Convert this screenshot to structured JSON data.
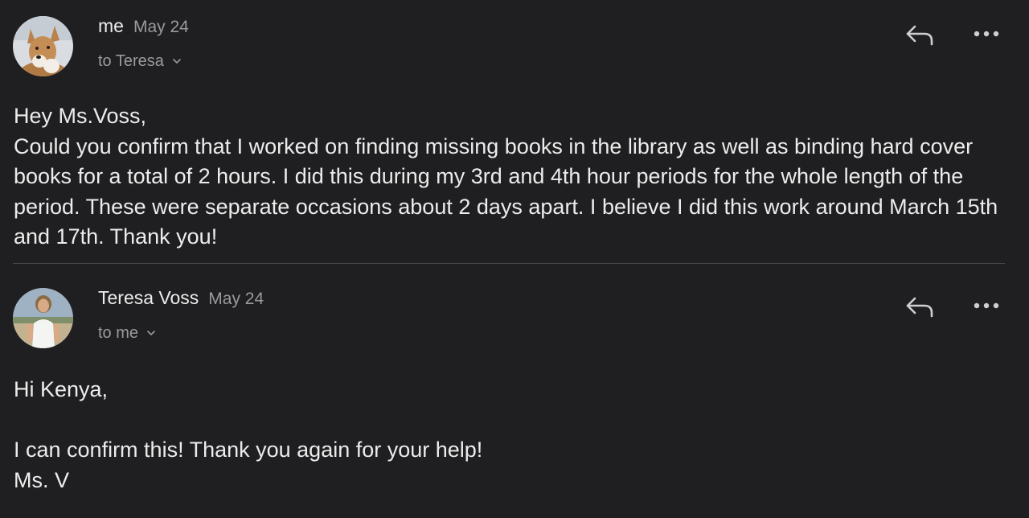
{
  "thread": {
    "messages": [
      {
        "sender": "me",
        "date": "May 24",
        "recipient_line": "to Teresa",
        "avatar": "dog-photo-avatar",
        "body": "Hey Ms.Voss,\nCould you confirm that I worked on finding missing books in the library as well as binding hard cover books for a total of 2 hours. I did this during my 3rd and 4th hour periods for the whole length of the period. These were separate occasions about 2 days apart. I believe I did this work around March 15th and 17th. Thank you!"
      },
      {
        "sender": "Teresa Voss",
        "date": "May 24",
        "recipient_line": "to me",
        "avatar": "person-photo-avatar",
        "body": "Hi Kenya,\n\nI can confirm this! Thank you again for your help!\nMs. V"
      }
    ]
  },
  "icons": {
    "reply": "reply-arrow-icon",
    "more": "more-horizontal-icon",
    "expand": "chevron-down-icon"
  },
  "colors": {
    "background": "#1f1f21",
    "text_primary": "#ececec",
    "text_secondary": "#9a9a9e",
    "divider": "#48484c"
  }
}
